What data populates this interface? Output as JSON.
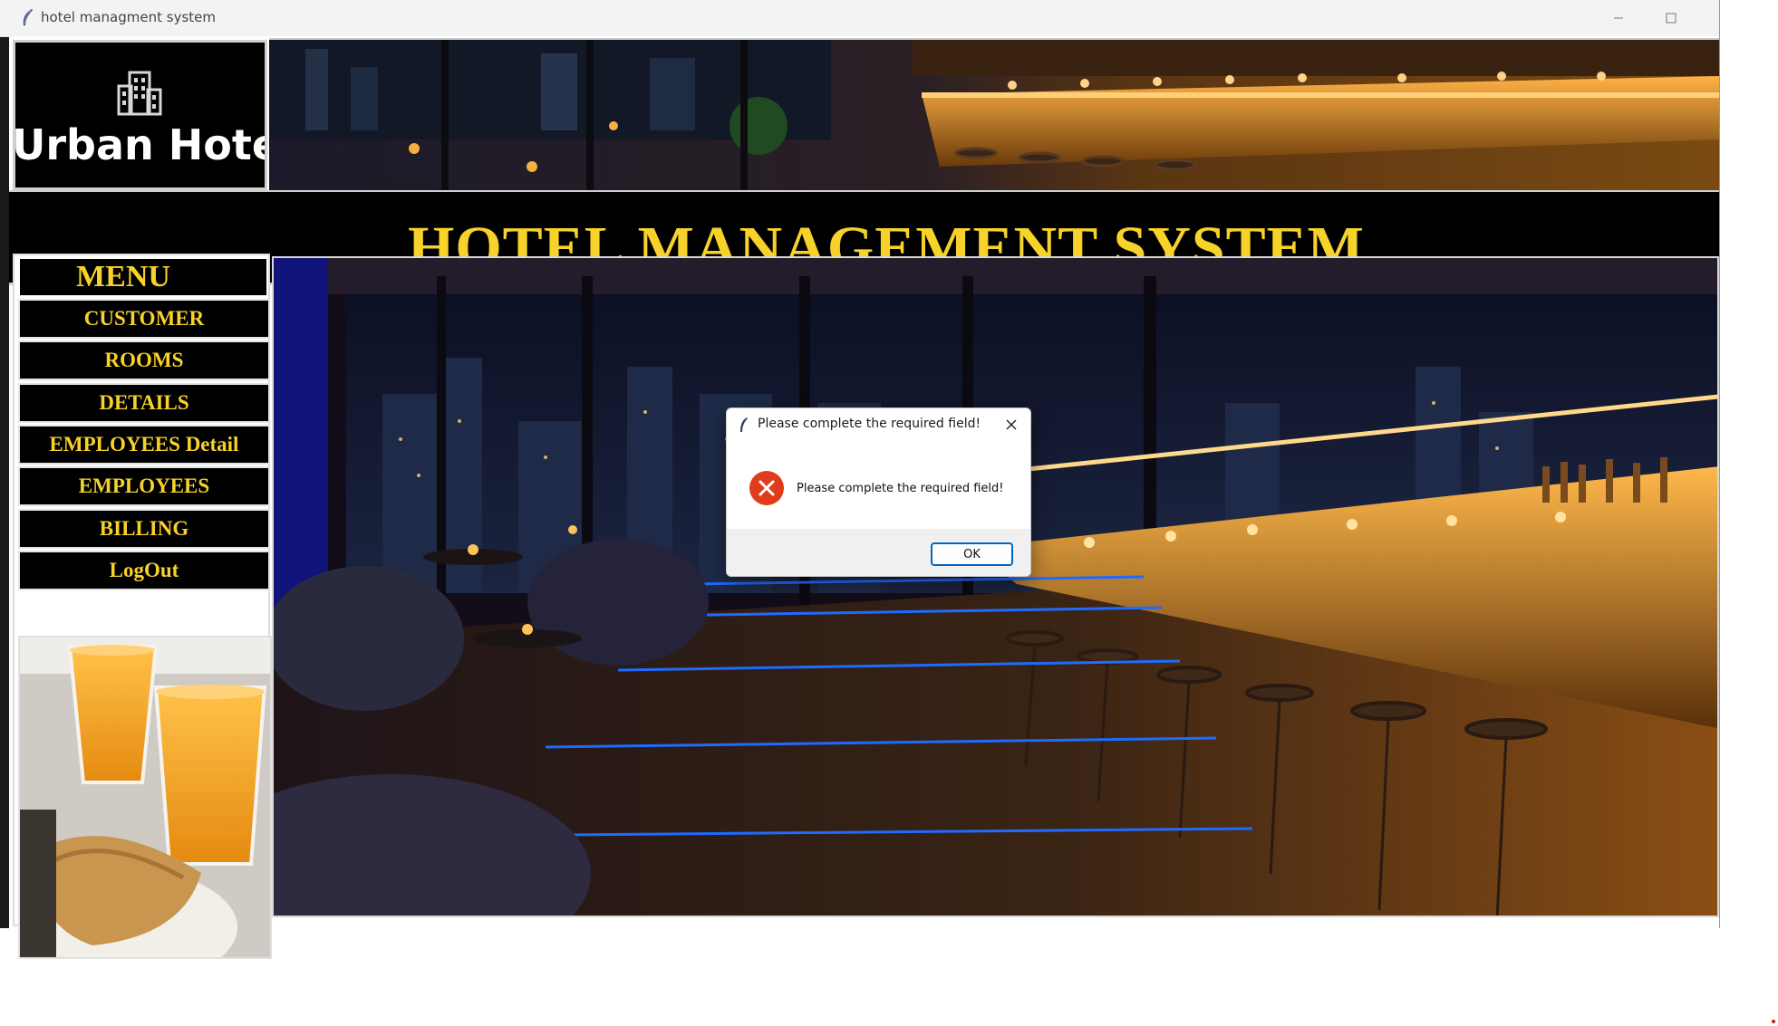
{
  "window": {
    "title": "hotel managment system",
    "minimize_icon": "minimize-icon",
    "maximize_icon": "maximize-icon"
  },
  "logo": {
    "text": "Urban Hotel",
    "icon": "building-icon"
  },
  "header": {
    "heading": "HOTEL MANAGEMENT SYSTEM"
  },
  "menu": {
    "title": "MENU",
    "items": [
      {
        "label": "CUSTOMER"
      },
      {
        "label": "ROOMS"
      },
      {
        "label": "DETAILS"
      },
      {
        "label": "EMPLOYEES Detail"
      },
      {
        "label": "EMPLOYEES"
      },
      {
        "label": "BILLING"
      },
      {
        "label": "LogOut"
      }
    ]
  },
  "dialog": {
    "title": "Please complete the required field!",
    "message": "Please complete the required field!",
    "ok_label": "OK",
    "icon": "error-icon"
  },
  "colors": {
    "accent_text": "#f6d22a",
    "menu_bg": "#000000",
    "dialog_button_border": "#0067c0",
    "error_icon": "#e03c1c"
  }
}
